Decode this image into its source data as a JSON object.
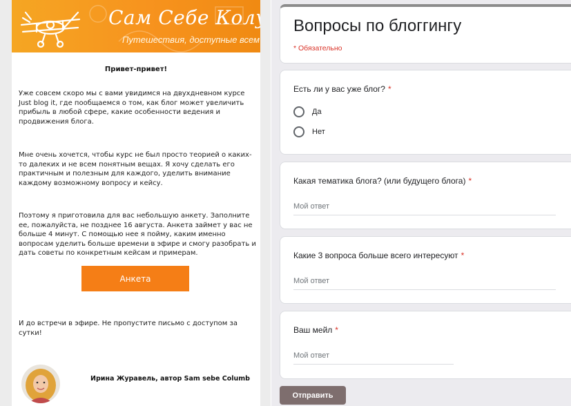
{
  "email": {
    "banner": {
      "title": "Сам Себе Колумб",
      "subtitle": "Путешествия, доступные всем",
      "color": "#f7931e"
    },
    "greeting": "Привет-привет!",
    "paragraphs": [
      "Уже совсем скоро мы с вами увидимся на двухдневном курсе Just blog it, где пообщаемся о том, как блог может увеличить прибыль в любой сфере, какие особенности ведения и продвижения блога.",
      "Мне очень хочется, чтобы курс не был просто теорией о каких-то далеких и не всем понятным вещах. Я хочу сделать его практичным и полезным для каждого, уделить внимание каждому возможному вопросу и кейсу.",
      "Поэтому я приготовила для вас небольшую анкету. Заполните ее, пожалуйста, не позднее 16 августа. Анкета займет у вас не больше 4 минут. С помощью нее я пойму, каким именно вопросам уделить больше времени в эфире и смогу разобрать и дать советы по конкретным кейсам и примерам.",
      "И до встречи в эфире. Не пропустите письмо с доступом за сутки!"
    ],
    "button_label": "Анкета",
    "button_color": "#f57e16",
    "signature": "Ирина Журавель, автор Sam sebe Columb"
  },
  "form": {
    "title": "Вопросы по блоггингу",
    "required_note": "* Обязательно",
    "questions": [
      {
        "title": "Есть ли у вас уже блог?",
        "required": "*",
        "options": [
          "Да",
          "Нет"
        ]
      },
      {
        "title": "Какая тематика блога? (или будущего блога)",
        "required": "*",
        "placeholder": "Мой ответ"
      },
      {
        "title": "Какие 3 вопроса больше всего интересуют",
        "required": "*",
        "placeholder": "Мой ответ"
      },
      {
        "title": "Ваш мейл",
        "required": "*",
        "placeholder": "Мой ответ"
      }
    ],
    "submit_label": "Отправить",
    "accent_color": "#d93025"
  }
}
